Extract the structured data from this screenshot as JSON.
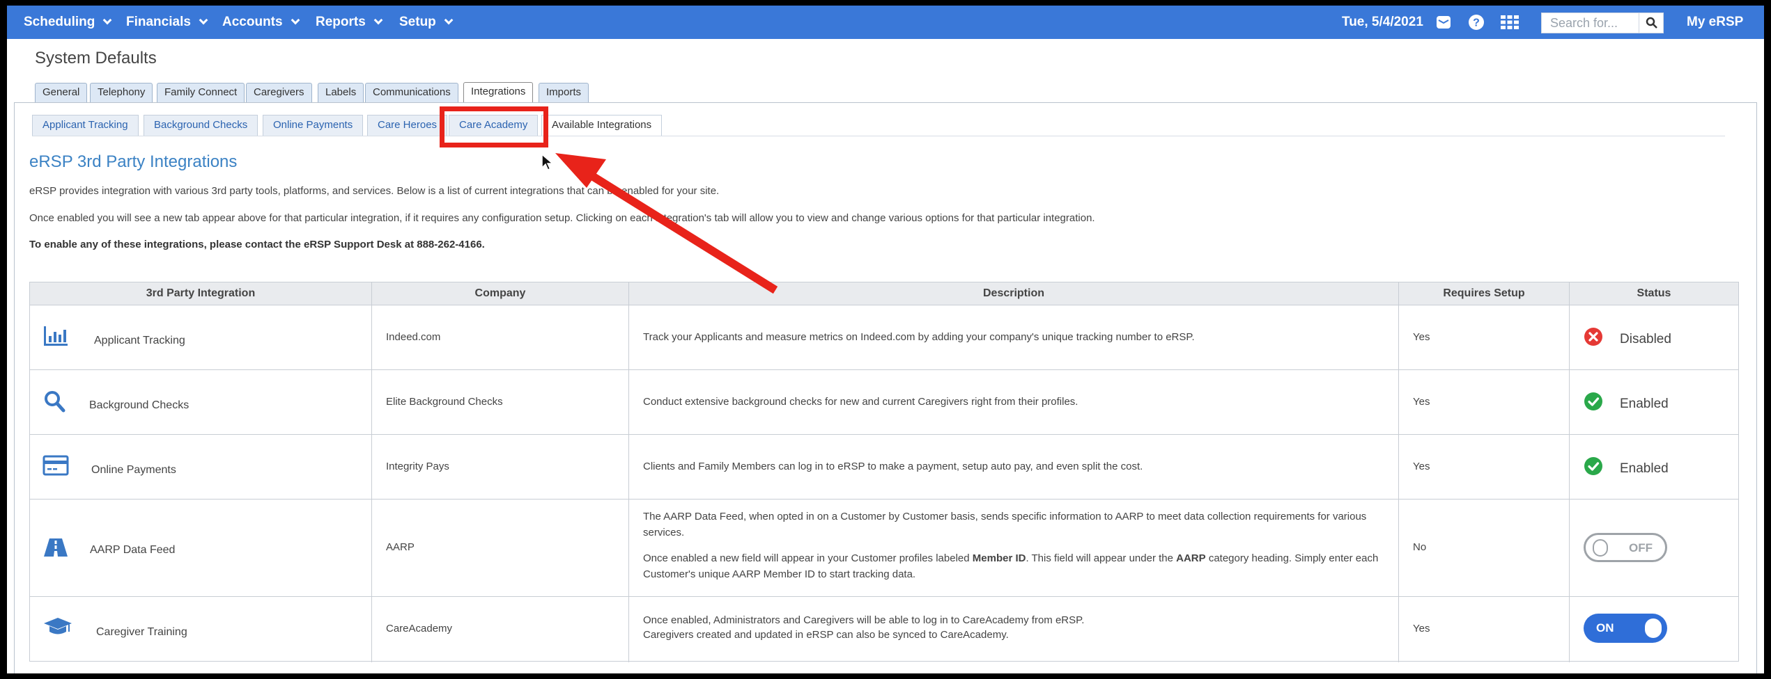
{
  "nav": {
    "items": [
      "Scheduling",
      "Financials",
      "Accounts",
      "Reports",
      "Setup"
    ],
    "date": "Tue, 5/4/2021",
    "search_placeholder": "Search for...",
    "account": "My eRSP"
  },
  "page_title": "System Defaults",
  "tabs": [
    "General",
    "Telephony",
    "Family Connect",
    "Caregivers",
    "Labels",
    "Communications",
    "Integrations",
    "Imports"
  ],
  "active_tab": "Integrations",
  "subtabs": [
    "Applicant Tracking",
    "Background Checks",
    "Online Payments",
    "Care Heroes",
    "Care Academy",
    "Available Integrations"
  ],
  "active_subtab": "Available Integrations",
  "content": {
    "heading": "eRSP 3rd Party Integrations",
    "p1": "eRSP provides integration with various 3rd party tools, platforms, and services. Below is a list of current integrations that can be enabled for your site.",
    "p2": "Once enabled you will see a new tab appear above for that particular integration, if it requires any configuration setup. Clicking on each integration's tab will allow you to view and change various options for that particular integration.",
    "p3": "To enable any of these integrations, please contact the eRSP Support Desk at 888-262-4166."
  },
  "table": {
    "headers": [
      "3rd Party Integration",
      "Company",
      "Description",
      "Requires Setup",
      "Status"
    ],
    "rows": [
      {
        "name": "Applicant Tracking",
        "icon": "bar-chart-icon",
        "company": "Indeed.com",
        "description": "Track your Applicants and measure metrics on Indeed.com by adding your company's unique tracking number to eRSP.",
        "setup": "Yes",
        "status": "Disabled"
      },
      {
        "name": "Background Checks",
        "icon": "search-icon",
        "company": "Elite Background Checks",
        "description": "Conduct extensive background checks for new and current Caregivers right from their profiles.",
        "setup": "Yes",
        "status": "Enabled"
      },
      {
        "name": "Online Payments",
        "icon": "credit-card-icon",
        "company": "Integrity Pays",
        "description": "Clients and Family Members can log in to eRSP to make a payment, setup auto pay, and even split the cost.",
        "setup": "Yes",
        "status": "Enabled"
      },
      {
        "name": "AARP Data Feed",
        "icon": "road-icon",
        "company": "AARP",
        "description_1": "The AARP Data Feed, when opted in on a Customer by Customer basis, sends specific information to AARP to meet data collection requirements for various services.",
        "description_2a": "Once enabled a new field will appear in your Customer profiles labeled ",
        "description_2b": "Member ID",
        "description_2c": ". This field will appear under the ",
        "description_2d": "AARP",
        "description_2e": " category heading. Simply enter each Customer's unique AARP Member ID to start tracking data.",
        "setup": "No",
        "status": "OFF"
      },
      {
        "name": "Caregiver Training",
        "icon": "graduation-cap-icon",
        "company": "CareAcademy",
        "description_1": "Once enabled, Administrators and Caregivers will be able to log in to CareAcademy from eRSP.",
        "description_2": "Caregivers created and updated in eRSP can also be synced to CareAcademy.",
        "setup": "Yes",
        "status": "ON"
      }
    ]
  },
  "colors": {
    "nav_bg": "#3a78d8",
    "heading": "#3b82c4",
    "enabled": "#2aa84a",
    "disabled": "#e53935",
    "annotation": "#e8231a",
    "toggle_on": "#2f6ed8"
  }
}
